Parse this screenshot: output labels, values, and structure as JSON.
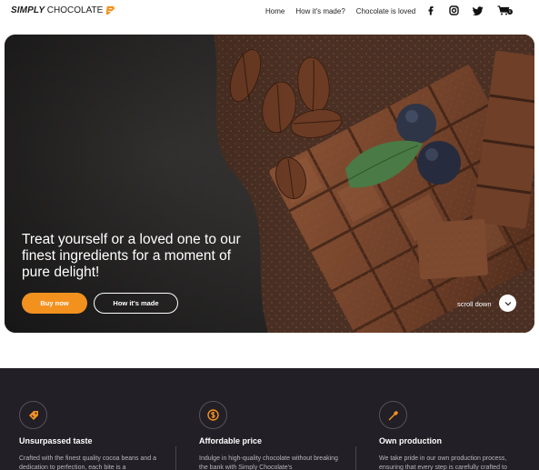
{
  "brand": {
    "name_part1": "SIMPLY",
    "name_part2": "CHOCOLATE",
    "accent": "#f3911f"
  },
  "nav": {
    "items": [
      {
        "label": "Home"
      },
      {
        "label": "How it's made?"
      },
      {
        "label": "Chocolate is loved"
      }
    ]
  },
  "socials": {
    "items": [
      {
        "icon": "facebook-icon"
      },
      {
        "icon": "instagram-icon"
      },
      {
        "icon": "twitter-icon"
      },
      {
        "icon": "cart-icon"
      }
    ],
    "cart_count": "0"
  },
  "hero": {
    "title": "Treat yourself or a loved one to our finest ingredients for a moment of pure delight!",
    "primary_button": "Buy now",
    "secondary_button": "How it's made",
    "scroll_label": "scroll down"
  },
  "features": [
    {
      "icon": "tag-icon",
      "title": "Unsurpassed taste",
      "text": "Crafted with the finest quality cocoa beans and a dedication to perfection, each bite is a"
    },
    {
      "icon": "coin-icon",
      "title": "Affordable price",
      "text": "Indulge in high-quality chocolate without breaking the bank with Simply Chocolate's"
    },
    {
      "icon": "spoon-icon",
      "title": "Own production",
      "text": "We take pride in our own production process, ensuring that every step is carefully crafted to"
    }
  ]
}
